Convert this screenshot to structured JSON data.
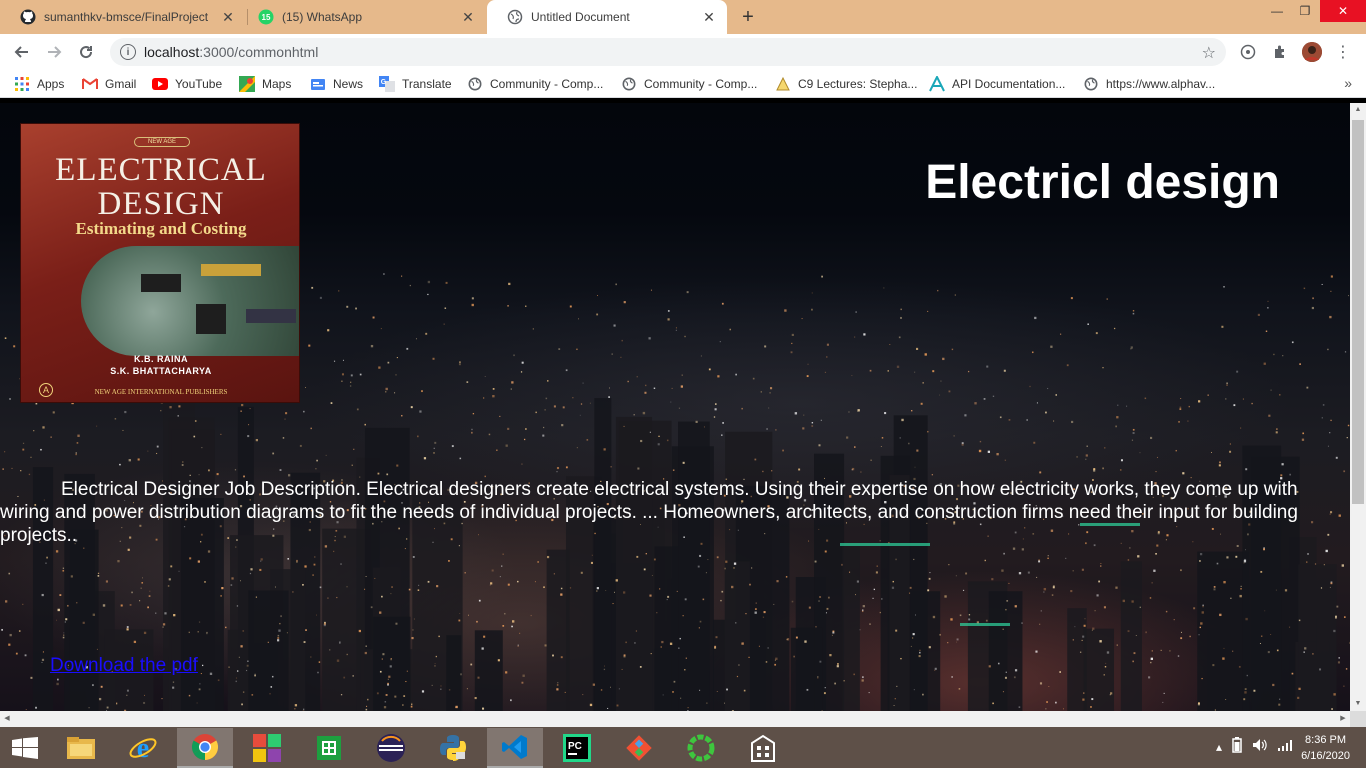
{
  "browser": {
    "tabs": [
      {
        "title": "sumanthkv-bmsce/FinalProject",
        "icon": "github-icon"
      },
      {
        "title": "(15) WhatsApp",
        "icon": "whatsapp-icon",
        "badge": "15"
      },
      {
        "title": "Untitled Document",
        "icon": "globe-icon"
      }
    ],
    "tab_close": "✕",
    "new_tab": "+",
    "window_controls": {
      "minimize": "—",
      "maximize": "❐",
      "close": "✕"
    },
    "url_host": "localhost",
    "url_path": ":3000/commonhtml",
    "bookmarks": [
      {
        "label": "Apps",
        "icon": "apps-grid-icon"
      },
      {
        "label": "Gmail",
        "icon": "gmail-icon"
      },
      {
        "label": "YouTube",
        "icon": "youtube-icon"
      },
      {
        "label": "Maps",
        "icon": "maps-icon"
      },
      {
        "label": "News",
        "icon": "news-icon"
      },
      {
        "label": "Translate",
        "icon": "translate-icon"
      },
      {
        "label": "Community - Comp...",
        "icon": "globe-icon"
      },
      {
        "label": "Community - Comp...",
        "icon": "globe-icon"
      },
      {
        "label": "C9 Lectures: Stepha...",
        "icon": "c9-icon"
      },
      {
        "label": "API Documentation...",
        "icon": "api-icon"
      },
      {
        "label": "https://www.alphav...",
        "icon": "globe-icon"
      }
    ],
    "bookmarks_more": "»"
  },
  "page": {
    "heading": "Electricl design",
    "description": "Electrical Designer Job Description. Electrical designers create electrical systems. Using their expertise on how electricity works, they come up with wiring and power distribution diagrams to fit the needs of individual projects. ... Homeowners, architects, and construction firms need their input for building projects..",
    "download_link": "Download the pdf",
    "book_cover": {
      "badge": "NEW AGE",
      "title_line1": "ELECTRICAL",
      "title_line2": "DESIGN",
      "subtitle": "Estimating and Costing",
      "author1": "K.B. RAINA",
      "author2": "S.K. BHATTACHARYA",
      "publisher": "NEW AGE INTERNATIONAL PUBLISHERS"
    }
  },
  "taskbar": {
    "apps": [
      {
        "name": "file-explorer",
        "icon": "folder-icon"
      },
      {
        "name": "internet-explorer",
        "icon": "ie-icon"
      },
      {
        "name": "chrome",
        "icon": "chrome-icon",
        "active": true
      },
      {
        "name": "office",
        "icon": "office-icon"
      },
      {
        "name": "excel",
        "icon": "excel-icon"
      },
      {
        "name": "eclipse",
        "icon": "eclipse-icon"
      },
      {
        "name": "python",
        "icon": "python-icon"
      },
      {
        "name": "vscode",
        "icon": "vscode-icon",
        "active": true
      },
      {
        "name": "pycharm",
        "icon": "pycharm-icon"
      },
      {
        "name": "git",
        "icon": "git-icon"
      },
      {
        "name": "spinner-app",
        "icon": "green-ring-icon"
      },
      {
        "name": "calculator-like",
        "icon": "building-icon"
      }
    ],
    "time": "8:36 PM",
    "date": "6/16/2020"
  },
  "colors": {
    "tabstrip": "#e6b98b",
    "link": "#1a0dff",
    "taskbar": "#5e5048"
  }
}
